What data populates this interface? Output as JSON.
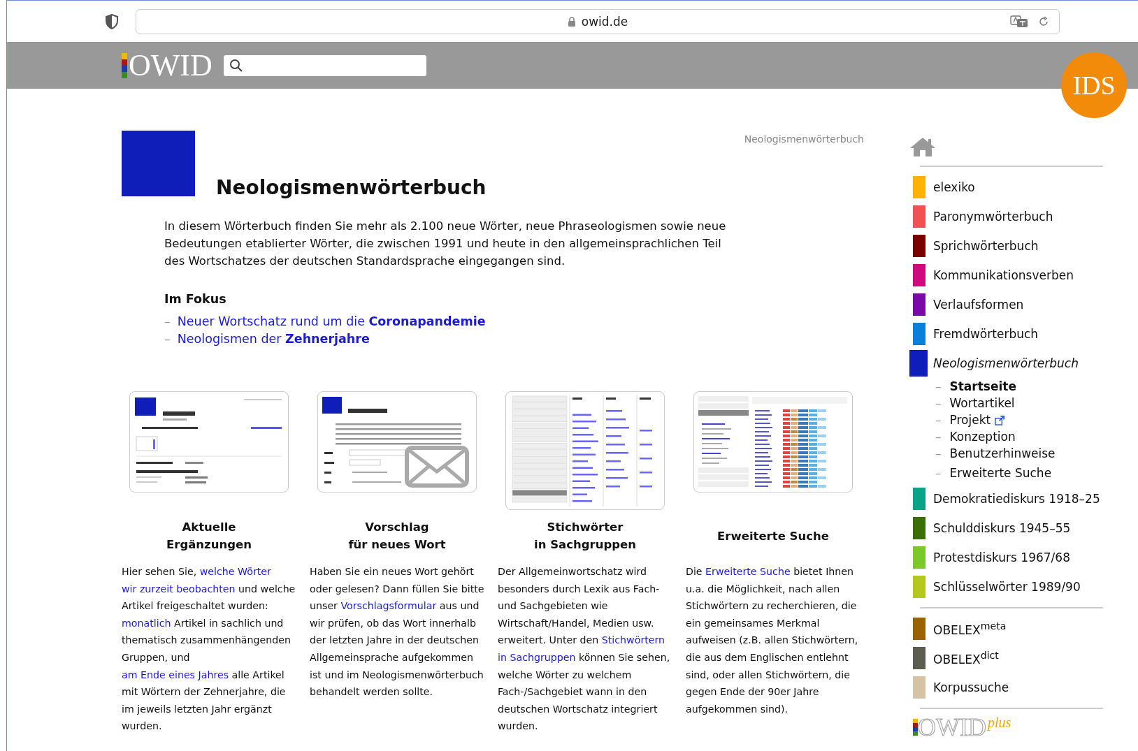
{
  "browser": {
    "url": "owid.de"
  },
  "header": {
    "logo": "OWID",
    "badge": "IDS"
  },
  "breadcrumb": "Neologismenwörterbuch",
  "title": "Neologismenwörterbuch",
  "intro": "In diesem Wörterbuch finden Sie mehr als 2.100 neue Wörter, neue Phraseologismen sowie neue Bedeutungen etablierter Wörter, die zwischen 1991 und heute in den allgemeinsprachlichen Teil des Wortschatzes der deutschen Standardsprache eingegangen sind.",
  "focus": {
    "heading": "Im Fokus",
    "links": [
      {
        "marker": "–",
        "text": "Neuer Wortschatz rund um die **Coronapandemie**"
      },
      {
        "marker": "–",
        "text": "Neologismen der **Zehnerjahre**"
      }
    ]
  },
  "cards": [
    {
      "kind": "entry",
      "title": "Aktuelle\nErgänzungen",
      "text": [
        {
          "text": "Hier sehen Sie, ",
          "link": false
        },
        {
          "text": "welche Wörter",
          "link": true
        },
        {
          "text": "wir zurzeit beobachten",
          "link": true
        },
        {
          "text": " und welche Artikel freigeschaltet wurden: ",
          "link": false
        },
        {
          "text": "monatlich",
          "link": true
        },
        {
          "text": " Artikel in sachlich und thematisch zusammenhängenden Gruppen, und ",
          "link": false
        },
        {
          "text": "am Ende eines Jahres",
          "link": true
        },
        {
          "text": " alle Artikel mit Wörtern der Zehnerjahre, die im jeweils letzten Jahr ergänzt wurden.",
          "link": false
        }
      ]
    },
    {
      "kind": "form",
      "title": "Vorschlag\nfür neues Wort",
      "text": [
        {
          "text": "Haben Sie ein neues Wort gehört oder gelesen? Dann füllen Sie bitte unser ",
          "link": false
        },
        {
          "text": "Vorschlagsformular",
          "link": true
        },
        {
          "text": " aus und wir prüfen, ob das Wort innerhalb der letzten Jahre in der deutschen Allgemeinsprache aufgekommen ist und im Neologismenwörterbuch behandelt werden sollte.",
          "link": false
        }
      ]
    },
    {
      "kind": "categories",
      "title": "Stichwörter\nin Sachgruppen",
      "text": [
        {
          "text": "Der Allgemeinwortschatz wird besonders durch Lexik aus Fach- und Sachgebieten wie Wirtschaft/Handel, Medien usw. erweitert. Unter den ",
          "link": false
        },
        {
          "text": "Stichwörtern",
          "link": true
        },
        {
          "text": "in Sachgruppen",
          "link": true
        },
        {
          "text": " können Sie sehen, welche Wörter zu welchem Fach-/Sachgebiet wann in den deutschen Wortschatz integriert wurden.",
          "link": false
        }
      ]
    },
    {
      "kind": "search",
      "title": "Erweiterte Suche",
      "text": [
        {
          "text": "Die ",
          "link": false
        },
        {
          "text": "Erweiterte Suche",
          "link": true
        },
        {
          "text": " bietet Ihnen u.a. die Möglichkeit, nach allen Stichwörtern zu recherchieren, die ein gemeinsames Merkmal aufweisen (z.B. allen Stichwörtern, die aus dem Englischen entlehnt sind, oder allen Stichwörtern, die gegen Ende der 90er Jahre aufgekommen sind).",
          "link": false
        }
      ]
    }
  ],
  "sidebar": {
    "groups": [
      {
        "items": [
          {
            "label": "elexiko",
            "color": "#ffb300",
            "selected": false
          },
          {
            "label": "Paronymwörterbuch",
            "color": "#f25052",
            "selected": false
          },
          {
            "label": "Sprichwörterbuch",
            "color": "#7a0000",
            "selected": false
          },
          {
            "label": "Kommunikationsverben",
            "color": "#d2087f",
            "selected": false
          },
          {
            "label": "Verlaufsformen",
            "color": "#780aa8",
            "selected": false
          },
          {
            "label": "Fremdwörterbuch",
            "color": "#0a80da",
            "selected": false
          },
          {
            "label": "Neologismenwörterbuch",
            "color": "#0f1eb8",
            "selected": true,
            "children": [
              {
                "marker": "–",
                "label": "Startseite",
                "selected": true,
                "external": false
              },
              {
                "marker": "–",
                "label": "Wortartikel",
                "selected": false,
                "external": false
              },
              {
                "marker": "–",
                "label": "Projekt",
                "selected": false,
                "external": true
              },
              {
                "marker": "–",
                "label": "Konzeption",
                "selected": false,
                "external": false
              },
              {
                "marker": "–",
                "label": "Benutzerhinweise",
                "selected": false,
                "external": false
              },
              {
                "marker": "–",
                "label": "Erweiterte Suche",
                "selected": false,
                "external": false
              }
            ]
          },
          {
            "label": "Demokratiediskurs 1918–25",
            "color": "#0aa388",
            "selected": false
          },
          {
            "label": "Schulddiskurs 1945–55",
            "color": "#3a6e08",
            "selected": false
          },
          {
            "label": "Protestdiskurs 1967/68",
            "color": "#7ac82a",
            "selected": false
          },
          {
            "label": "Schlüsselwörter 1989/90",
            "color": "#b5c81e",
            "selected": false
          }
        ]
      },
      {
        "items": [
          {
            "label": "OBELEX$^{meta}$",
            "color": "#9a6200",
            "selected": false
          },
          {
            "label": "OBELEX$^{dict}$",
            "color": "#5c5c50",
            "selected": false
          },
          {
            "label": "Korpussuche",
            "color": "#d4c4a4",
            "selected": false
          }
        ]
      }
    ],
    "footer_logo": {
      "text": "OWID",
      "sup": "plus"
    }
  }
}
